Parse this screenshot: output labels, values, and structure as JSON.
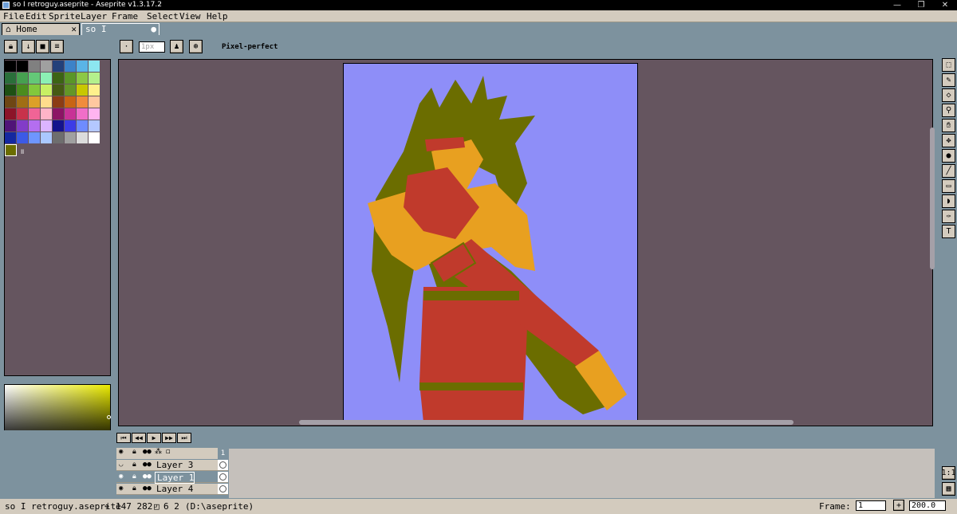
{
  "window": {
    "title": "so I retroguy.aseprite - Aseprite v1.3.17.2"
  },
  "menu": [
    "File",
    "Edit",
    "Sprite",
    "Layer",
    "Frame",
    "Select",
    "View",
    "Help"
  ],
  "tabs": {
    "home": "Home",
    "document": "so I retroguy.a"
  },
  "context_bar": {
    "brush_size_placeholder": "1px",
    "pixel_perfect_label": "Pixel-perfect"
  },
  "palette": {
    "swatches": [
      "#000000",
      "#000000",
      "#808080",
      "#a0a0a0",
      "#23407a",
      "#3c82c8",
      "#5ab4e6",
      "#8ce6f0",
      "#2a6f3a",
      "#46a050",
      "#64c878",
      "#8cf0b4",
      "#3c6414",
      "#5a9628",
      "#8cc846",
      "#b4f08c",
      "#1e5014",
      "#4b8c1e",
      "#82c83c",
      "#c8f064",
      "#465a14",
      "#649628",
      "#c8c800",
      "#fff08c",
      "#6e4614",
      "#a06e14",
      "#dca028",
      "#ffdc8c",
      "#8c3c14",
      "#c86414",
      "#f08c3c",
      "#ffc8a0",
      "#8c1428",
      "#c8324b",
      "#f06496",
      "#ffb4c8",
      "#8c1464",
      "#c83296",
      "#f06ec8",
      "#ffb4f0",
      "#501478",
      "#823cc8",
      "#b46ef0",
      "#dcb4ff",
      "#14148c",
      "#3c3ce6",
      "#6e8cff",
      "#b4c8ff",
      "#1428a0",
      "#3c5ae6",
      "#6e96ff",
      "#aac8ff",
      "#6e6e6e",
      "#a0a0a0",
      "#dcdcdc",
      "#ffffff"
    ],
    "fg_hex": "#6b6d00",
    "bg_hex": "#000000"
  },
  "timeline": {
    "frame_number": "1",
    "layers": [
      {
        "name": "Layer 3",
        "selected": false
      },
      {
        "name": "Layer 1",
        "selected": true
      },
      {
        "name": "Layer 4",
        "selected": false
      }
    ]
  },
  "status": {
    "filename": "so I retroguy.aseprite",
    "cursor_pos": "147 282",
    "size": "6 2",
    "path": "(D:\\aseprite)",
    "frame_label": "Frame:",
    "frame_value": "1",
    "zoom_value": "200.0"
  },
  "colors": {
    "canvas_bg": "#8e8ef8",
    "olive": "#6b6d00",
    "red": "#c03a2c",
    "orange": "#e8a020"
  }
}
